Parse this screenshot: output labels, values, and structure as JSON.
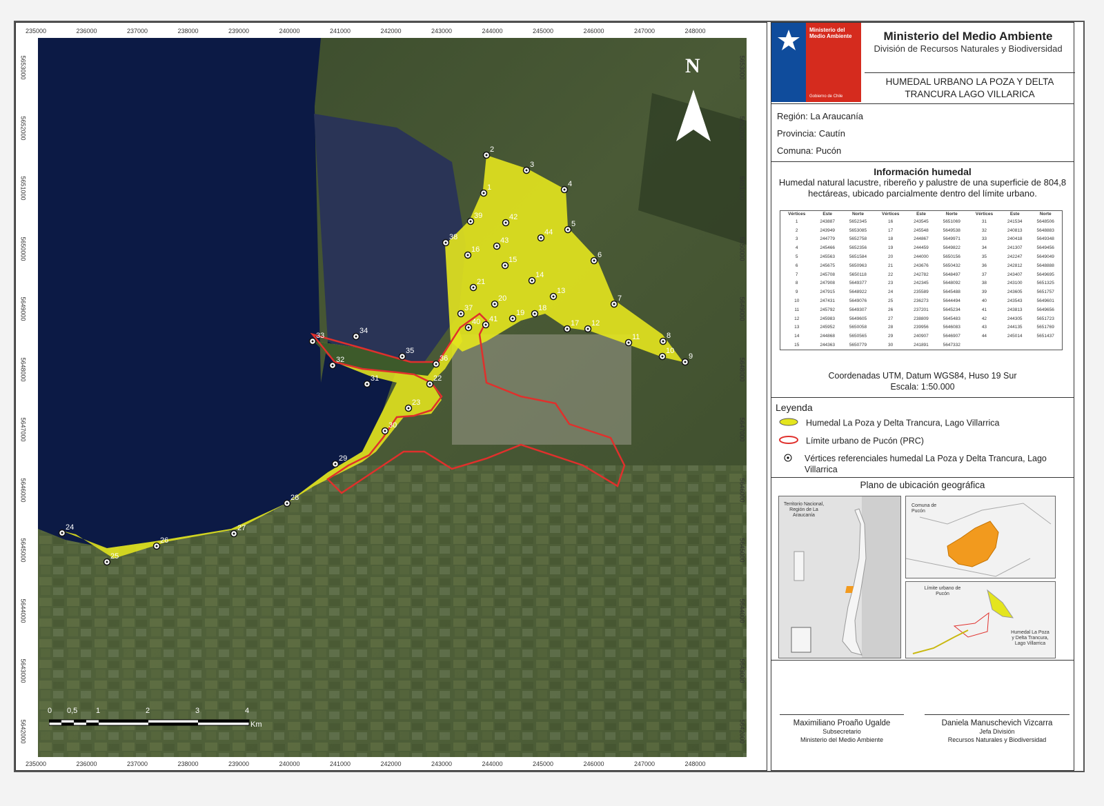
{
  "map": {
    "x_ticks": [
      "235000",
      "236000",
      "237000",
      "238000",
      "239000",
      "240000",
      "241000",
      "242000",
      "243000",
      "244000",
      "245000",
      "246000",
      "247000",
      "248000"
    ],
    "y_ticks": [
      "5653000",
      "5652000",
      "5651000",
      "5650000",
      "5649000",
      "5648000",
      "5647000",
      "5646000",
      "5645000",
      "5644000",
      "5643000",
      "5642000"
    ],
    "north": "N",
    "scale_labels": [
      "0",
      "0,5",
      "1",
      "2",
      "3",
      "4"
    ],
    "scale_unit": "Km",
    "vertex_labels": [
      "1",
      "2",
      "3",
      "4",
      "5",
      "6",
      "7",
      "8",
      "9",
      "10",
      "11",
      "12",
      "13",
      "14",
      "15",
      "16",
      "17",
      "18",
      "19",
      "20",
      "21",
      "22",
      "23",
      "24",
      "25",
      "26",
      "27",
      "28",
      "29",
      "30",
      "31",
      "32",
      "33",
      "34",
      "35",
      "36",
      "37",
      "38",
      "39",
      "40",
      "41",
      "42",
      "43",
      "44"
    ],
    "colors": {
      "wetland": "#e4e51e",
      "urban_limit": "#e0302c",
      "water": "#0c1a45"
    }
  },
  "header": {
    "logo_text": "Ministerio del Medio Ambiente",
    "logo_footer": "Gobierno de Chile",
    "ministry": "Ministerio del Medio Ambiente",
    "division": "División de Recursos Naturales y Biodiversidad",
    "title": "HUMEDAL URBANO LA POZA Y DELTA TRANCURA LAGO VILLARICA"
  },
  "location": {
    "region": "Región: La Araucanía",
    "provincia": "Provincia: Cautín",
    "comuna": "Comuna: Pucón"
  },
  "info": {
    "title": "Información humedal",
    "description": "Humedal natural lacustre, ribereño y palustre de una superficie de 804,8 hectáreas, ubicado parcialmente dentro del límite urbano.",
    "columns": [
      "Vértices",
      "Este",
      "Norte",
      "Vértices",
      "Este",
      "Norte",
      "Vértices",
      "Este",
      "Norte"
    ],
    "rows": [
      [
        "1",
        "243887",
        "5652345",
        "16",
        "243545",
        "5651069",
        "31",
        "241534",
        "5648506"
      ],
      [
        "2",
        "243949",
        "5653085",
        "17",
        "245548",
        "5649538",
        "32",
        "240813",
        "5648883"
      ],
      [
        "3",
        "244779",
        "5652758",
        "18",
        "244867",
        "5649971",
        "33",
        "240418",
        "5649348"
      ],
      [
        "4",
        "245466",
        "5652356",
        "19",
        "244459",
        "5649822",
        "34",
        "241307",
        "5649456"
      ],
      [
        "5",
        "245563",
        "5651584",
        "20",
        "244000",
        "5650156",
        "35",
        "242247",
        "5649049"
      ],
      [
        "6",
        "245675",
        "5650963",
        "21",
        "243676",
        "5650432",
        "36",
        "242812",
        "5648888"
      ],
      [
        "7",
        "245708",
        "5650118",
        "22",
        "242782",
        "5648497",
        "37",
        "243407",
        "5649695"
      ],
      [
        "8",
        "247908",
        "5649377",
        "23",
        "242345",
        "5648092",
        "38",
        "243100",
        "5651325"
      ],
      [
        "9",
        "247915",
        "5648922",
        "24",
        "235589",
        "5645488",
        "39",
        "243605",
        "5651757"
      ],
      [
        "10",
        "247431",
        "5649076",
        "25",
        "236273",
        "5644494",
        "40",
        "243543",
        "5649601"
      ],
      [
        "11",
        "245792",
        "5649307",
        "26",
        "237201",
        "5645234",
        "41",
        "243813",
        "5649656"
      ],
      [
        "12",
        "245983",
        "5649605",
        "27",
        "238809",
        "5645483",
        "42",
        "244305",
        "5651723"
      ],
      [
        "13",
        "245952",
        "5650058",
        "28",
        "239956",
        "5646083",
        "43",
        "244135",
        "5651769"
      ],
      [
        "14",
        "244868",
        "5650565",
        "29",
        "240907",
        "5646907",
        "44",
        "245014",
        "5651437"
      ],
      [
        "15",
        "244363",
        "5650779",
        "30",
        "241891",
        "5647332",
        "",
        "",
        ""
      ]
    ],
    "coords": "Coordenadas UTM, Datum WGS84, Huso 19 Sur",
    "scale": "Escala: 1:50.000"
  },
  "legend": {
    "title": "Leyenda",
    "items": [
      "Humedal La Poza y Delta Trancura, Lago Villarrica",
      "Límite urbano de Pucón (PRC)",
      "Vértices referenciales humedal La Poza y Delta Trancura, Lago Villarrica"
    ]
  },
  "plano": {
    "title": "Plano de ubicación geográfica",
    "inset1": "Territorio Nacional, Región de La Araucanía",
    "inset2": "Comuna de Pucón",
    "inset3": "Límite urbano de Pucón",
    "inset3_note": "Humedal La Poza y Delta Trancura, Lago Villarrica"
  },
  "signatures": [
    {
      "name": "Maximiliano Proaño Ugalde",
      "role1": "Subsecretario",
      "role2": "Ministerio del Medio Ambiente"
    },
    {
      "name": "Daniela Manuschevich Vizcarra",
      "role1": "Jefa División",
      "role2": "Recursos Naturales y Biodiversidad"
    }
  ]
}
